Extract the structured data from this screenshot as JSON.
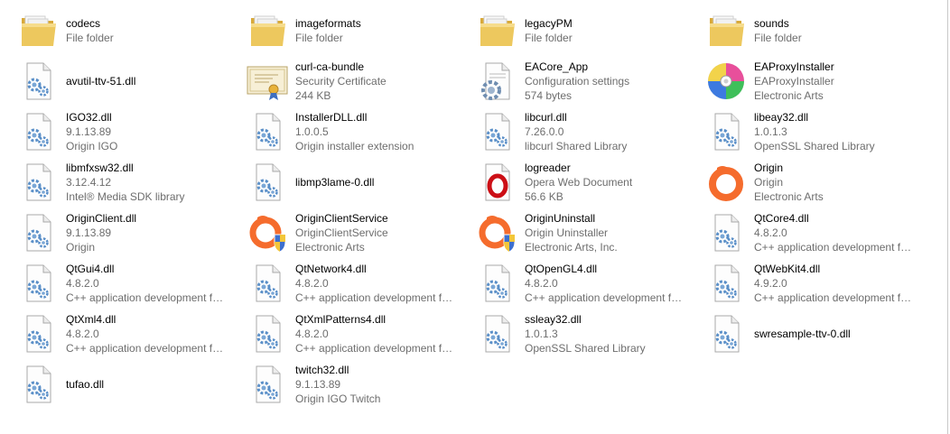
{
  "items": [
    {
      "name": "codecs",
      "line2": "File folder",
      "line3": "",
      "icon": "folder-icon"
    },
    {
      "name": "imageformats",
      "line2": "File folder",
      "line3": "",
      "icon": "folder-icon"
    },
    {
      "name": "legacyPM",
      "line2": "File folder",
      "line3": "",
      "icon": "folder-icon"
    },
    {
      "name": "sounds",
      "line2": "File folder",
      "line3": "",
      "icon": "folder-icon"
    },
    {
      "name": "avutil-ttv-51.dll",
      "line2": "",
      "line3": "",
      "icon": "dll-icon"
    },
    {
      "name": "curl-ca-bundle",
      "line2": "Security Certificate",
      "line3": "244 KB",
      "icon": "certificate-icon"
    },
    {
      "name": "EACore_App",
      "line2": "Configuration settings",
      "line3": "574 bytes",
      "icon": "config-settings-icon"
    },
    {
      "name": "EAProxyInstaller",
      "line2": "EAProxyInstaller",
      "line3": "Electronic Arts",
      "icon": "disc-installer-icon"
    },
    {
      "name": "IGO32.dll",
      "line2": "9.1.13.89",
      "line3": "Origin IGO",
      "icon": "dll-icon"
    },
    {
      "name": "InstallerDLL.dll",
      "line2": "1.0.0.5",
      "line3": "Origin installer extension",
      "icon": "dll-icon"
    },
    {
      "name": "libcurl.dll",
      "line2": "7.26.0.0",
      "line3": "libcurl Shared Library",
      "icon": "dll-icon"
    },
    {
      "name": "libeay32.dll",
      "line2": "1.0.1.3",
      "line3": "OpenSSL Shared Library",
      "icon": "dll-icon"
    },
    {
      "name": "libmfxsw32.dll",
      "line2": "3.12.4.12",
      "line3": "Intel® Media SDK library",
      "icon": "dll-icon"
    },
    {
      "name": "libmp3lame-0.dll",
      "line2": "",
      "line3": "",
      "icon": "dll-icon"
    },
    {
      "name": "logreader",
      "line2": "Opera Web Document",
      "line3": "56.6 KB",
      "icon": "opera-document-icon"
    },
    {
      "name": "Origin",
      "line2": "Origin",
      "line3": "Electronic Arts",
      "icon": "origin-icon"
    },
    {
      "name": "OriginClient.dll",
      "line2": "9.1.13.89",
      "line3": "Origin",
      "icon": "dll-icon"
    },
    {
      "name": "OriginClientService",
      "line2": "OriginClientService",
      "line3": "Electronic Arts",
      "icon": "origin-shield-icon"
    },
    {
      "name": "OriginUninstall",
      "line2": "Origin Uninstaller",
      "line3": "Electronic Arts, Inc.",
      "icon": "origin-shield-icon"
    },
    {
      "name": "QtCore4.dll",
      "line2": "4.8.2.0",
      "line3": "C++ application development fra...",
      "icon": "dll-icon"
    },
    {
      "name": "QtGui4.dll",
      "line2": "4.8.2.0",
      "line3": "C++ application development fra...",
      "icon": "dll-icon"
    },
    {
      "name": "QtNetwork4.dll",
      "line2": "4.8.2.0",
      "line3": "C++ application development fra...",
      "icon": "dll-icon"
    },
    {
      "name": "QtOpenGL4.dll",
      "line2": "4.8.2.0",
      "line3": "C++ application development fra...",
      "icon": "dll-icon"
    },
    {
      "name": "QtWebKit4.dll",
      "line2": "4.9.2.0",
      "line3": "C++ application development fra...",
      "icon": "dll-icon"
    },
    {
      "name": "QtXml4.dll",
      "line2": "4.8.2.0",
      "line3": "C++ application development fra...",
      "icon": "dll-icon"
    },
    {
      "name": "QtXmlPatterns4.dll",
      "line2": "4.8.2.0",
      "line3": "C++ application development fra...",
      "icon": "dll-icon"
    },
    {
      "name": "ssleay32.dll",
      "line2": "1.0.1.3",
      "line3": "OpenSSL Shared Library",
      "icon": "dll-icon"
    },
    {
      "name": "swresample-ttv-0.dll",
      "line2": "",
      "line3": "",
      "icon": "dll-icon"
    },
    {
      "name": "tufao.dll",
      "line2": "",
      "line3": "",
      "icon": "dll-icon"
    },
    {
      "name": "twitch32.dll",
      "line2": "9.1.13.89",
      "line3": "Origin IGO Twitch",
      "icon": "dll-icon"
    }
  ],
  "colors": {
    "folder": "#e8c15a",
    "secondary_text": "#6d6d6d",
    "origin_orange": "#f56c2d",
    "opera_red": "#cc0f16",
    "gear_blue": "#5a8fc8"
  }
}
